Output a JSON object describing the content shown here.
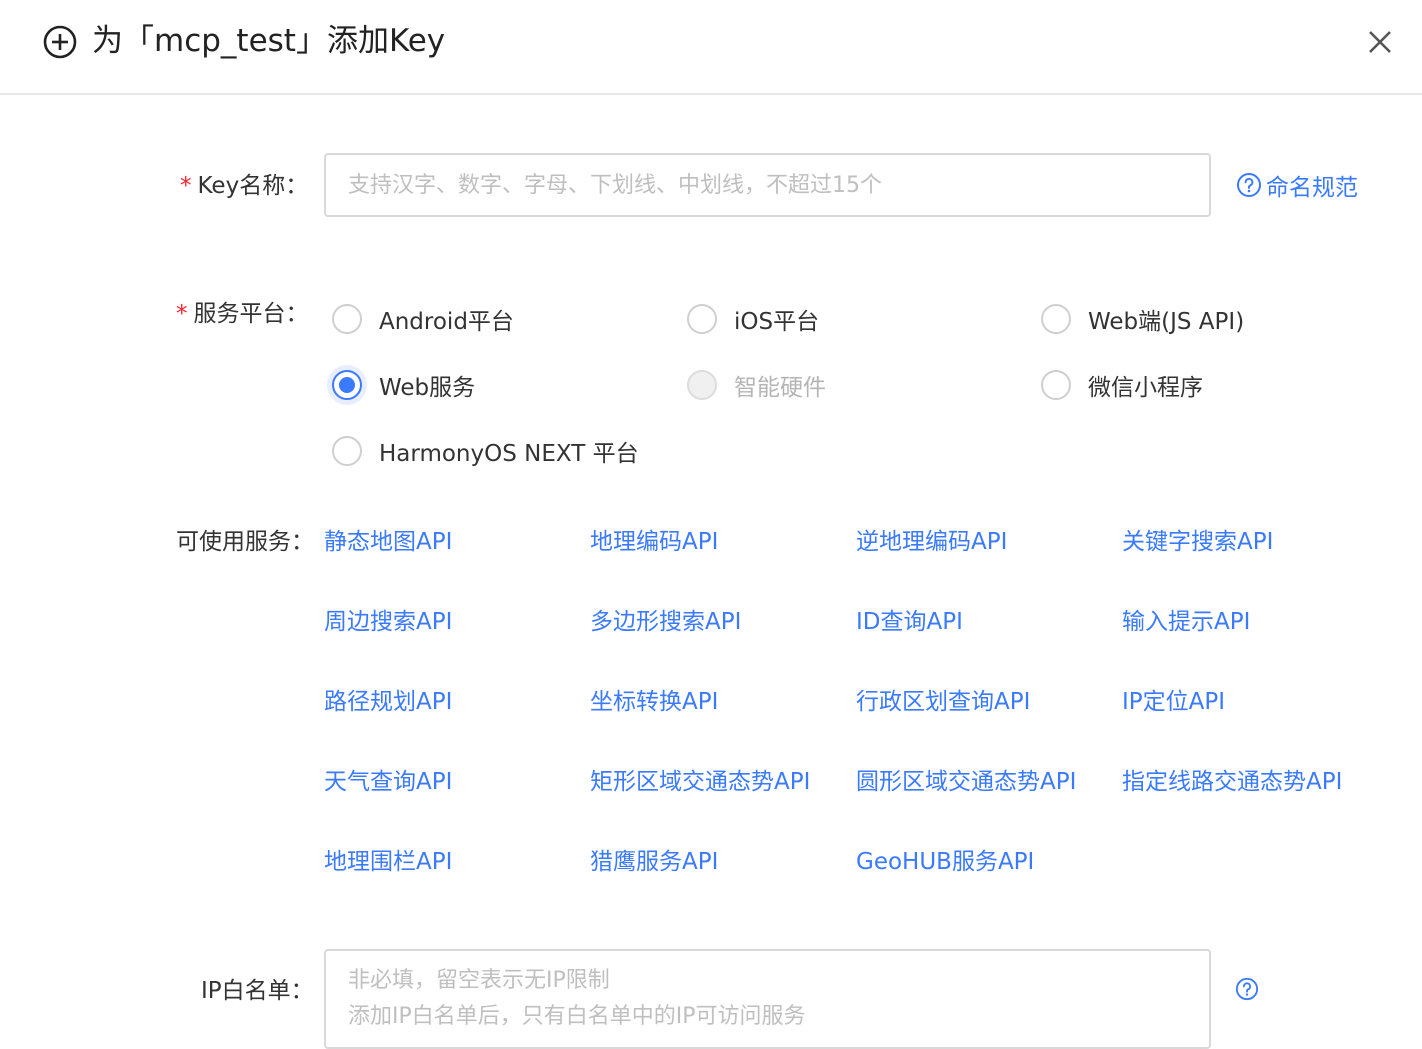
{
  "dialog": {
    "title": "为「mcp_test」添加Key",
    "close_icon": "close-icon",
    "title_icon": "plus-circle-icon"
  },
  "form": {
    "key_name": {
      "label": "Key名称：",
      "required": true,
      "placeholder": "支持汉字、数字、字母、下划线、中划线，不超过15个",
      "value": "",
      "help_link": "命名规范"
    },
    "platform": {
      "label": "服务平台：",
      "required": true,
      "options": [
        {
          "label": "Android平台",
          "selected": false,
          "disabled": false
        },
        {
          "label": "iOS平台",
          "selected": false,
          "disabled": false
        },
        {
          "label": "Web端(JS API)",
          "selected": false,
          "disabled": false
        },
        {
          "label": "Web服务",
          "selected": true,
          "disabled": false
        },
        {
          "label": "智能硬件",
          "selected": false,
          "disabled": true
        },
        {
          "label": "微信小程序",
          "selected": false,
          "disabled": false
        },
        {
          "label": "HarmonyOS NEXT 平台",
          "selected": false,
          "disabled": false
        }
      ]
    },
    "services": {
      "label": "可使用服务：",
      "items": [
        "静态地图API",
        "地理编码API",
        "逆地理编码API",
        "关键字搜索API",
        "周边搜索API",
        "多边形搜索API",
        "ID查询API",
        "输入提示API",
        "路径规划API",
        "坐标转换API",
        "行政区划查询API",
        "IP定位API",
        "天气查询API",
        "矩形区域交通态势API",
        "圆形区域交通态势API",
        "指定线路交通态势API",
        "地理围栏API",
        "猎鹰服务API",
        "GeoHUB服务API"
      ]
    },
    "ip_whitelist": {
      "label": "IP白名单：",
      "placeholder": "非必填，留空表示无IP限制\n添加IP白名单后，只有白名单中的IP可访问服务",
      "value": ""
    }
  },
  "colors": {
    "accent": "#3a7afe",
    "required": "#f5222d",
    "border": "#d9d9d9"
  }
}
